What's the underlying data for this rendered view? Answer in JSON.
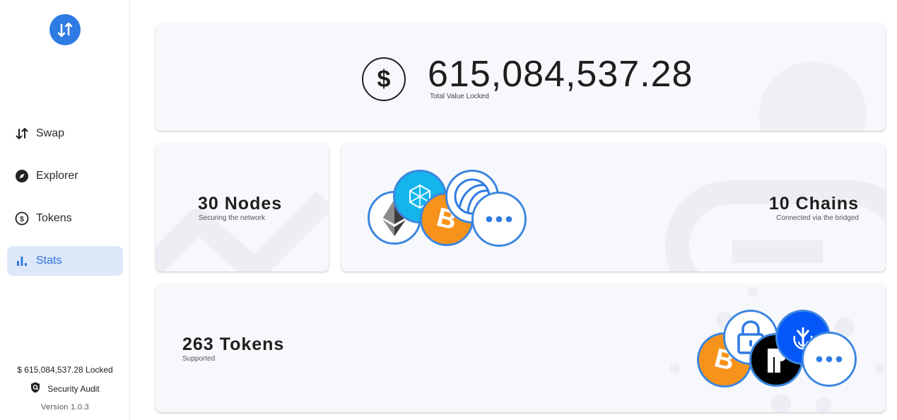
{
  "sidebar": {
    "logo_icon": "swap-arrows-logo",
    "items": [
      {
        "label": "Swap",
        "icon": "swap-arrows-icon",
        "active": false
      },
      {
        "label": "Explorer",
        "icon": "compass-icon",
        "active": false
      },
      {
        "label": "Tokens",
        "icon": "token-exchange-icon",
        "active": false
      },
      {
        "label": "Stats",
        "icon": "bar-chart-icon",
        "active": true
      }
    ],
    "locked_text": "$ 615,084,537.28 Locked",
    "audit_label": "Security Audit",
    "version": "Version 1.0.3"
  },
  "stats": {
    "tvl": {
      "symbol": "$",
      "value": "615,084,537.28",
      "label": "Total Value Locked"
    },
    "nodes": {
      "title": "30 Nodes",
      "subtitle": "Securing the network"
    },
    "chains": {
      "title": "10 Chains",
      "subtitle": "Connected via the bridged",
      "logos": [
        "ethereum",
        "fantom",
        "bitcoin",
        "chain-globe",
        "more"
      ]
    },
    "tokens": {
      "title": "263 Tokens",
      "subtitle": "Supported",
      "logos": [
        "bitcoin",
        "lock-token",
        "r-token",
        "yearn",
        "more"
      ]
    }
  },
  "colors": {
    "accent": "#2e7be3",
    "active_bg": "#dce8fa",
    "card_bg": "#f7f8fc",
    "bitcoin": "#f7931a",
    "fantom": "#13b5ec"
  }
}
